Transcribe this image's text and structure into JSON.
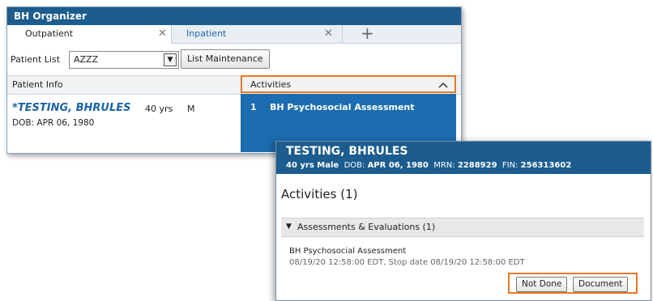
{
  "organizer": {
    "title": "BH Organizer",
    "tabs": [
      {
        "label": "Outpatient",
        "close": "✕"
      },
      {
        "label": "Inpatient",
        "close": "✕"
      }
    ],
    "add_tab": "+",
    "patient_list_label": "Patient List",
    "patient_list_value": "AZZZ",
    "list_maintenance": "List Maintenance",
    "columns": {
      "patient_info": "Patient Info",
      "activities": "Activities"
    },
    "collapse_icon": "chevron-up-icon",
    "row": {
      "name": "*TESTING, BHRULES",
      "age": "40 yrs",
      "sex": "M",
      "dob": "DOB: APR 06, 1980",
      "activity_number": "1",
      "activity": "BH Psychosocial Assessment"
    }
  },
  "detail": {
    "name": "TESTING, BHRULES",
    "age_sex": "40 yrs  Male",
    "dob_label": "DOB:",
    "dob": "APR 06, 1980",
    "mrn_label": "MRN:",
    "mrn": "2288929",
    "fin_label": "FIN:",
    "fin": "256313602",
    "activities_title": "Activities (1)",
    "section": "Assessments & Evaluations (1)",
    "item_name": "BH Psychosocial Assessment",
    "item_dates": "08/19/20 12:58:00 EDT, Stop date 08/19/20 12:58:00 EDT",
    "not_done": "Not Done",
    "document": "Document"
  },
  "colors": {
    "header_blue": "#1c5c8e",
    "selected_blue": "#1c6cb0",
    "highlight_orange": "#e87722",
    "link_blue": "#1c64a8"
  }
}
